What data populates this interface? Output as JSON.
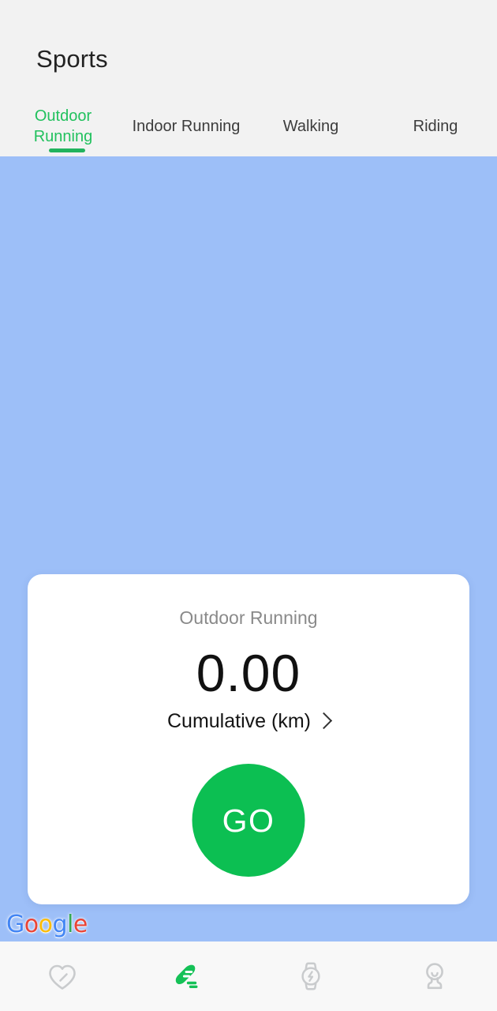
{
  "app": {
    "screen_title": "Sports",
    "background_color": "#9dbff8",
    "accent_color": "#22b35e",
    "go_button_color": "#0cbf52",
    "header_color": "#f2f2f2"
  },
  "tabs": [
    {
      "label": "Outdoor Running",
      "active": true
    },
    {
      "label": "Indoor Running",
      "active": false
    },
    {
      "label": "Walking",
      "active": false
    },
    {
      "label": "Riding",
      "active": false
    }
  ],
  "card": {
    "subtitle": "Outdoor Running",
    "value": "0.00",
    "metric_label": "Cumulative (km)",
    "chevron_icon": "chevron-right-icon",
    "go_label": "GO"
  },
  "watermark": {
    "letters": [
      {
        "char": "G",
        "color": "#4285F4"
      },
      {
        "char": "o",
        "color": "#EA4335"
      },
      {
        "char": "o",
        "color": "#FBBC05"
      },
      {
        "char": "g",
        "color": "#4285F4"
      },
      {
        "char": "l",
        "color": "#34A853"
      },
      {
        "char": "e",
        "color": "#EA4335"
      }
    ],
    "text": "Google"
  },
  "bottom_nav": [
    {
      "icon": "heart-health-icon",
      "label": "Health",
      "active": false,
      "color": "#c9cbcd"
    },
    {
      "icon": "running-shoe-icon",
      "label": "Sports",
      "active": true,
      "color": "#15c157"
    },
    {
      "icon": "watch-device-icon",
      "label": "Device",
      "active": false,
      "color": "#c9cbcd"
    },
    {
      "icon": "person-profile-icon",
      "label": "Profile",
      "active": false,
      "color": "#c9cbcd"
    }
  ]
}
